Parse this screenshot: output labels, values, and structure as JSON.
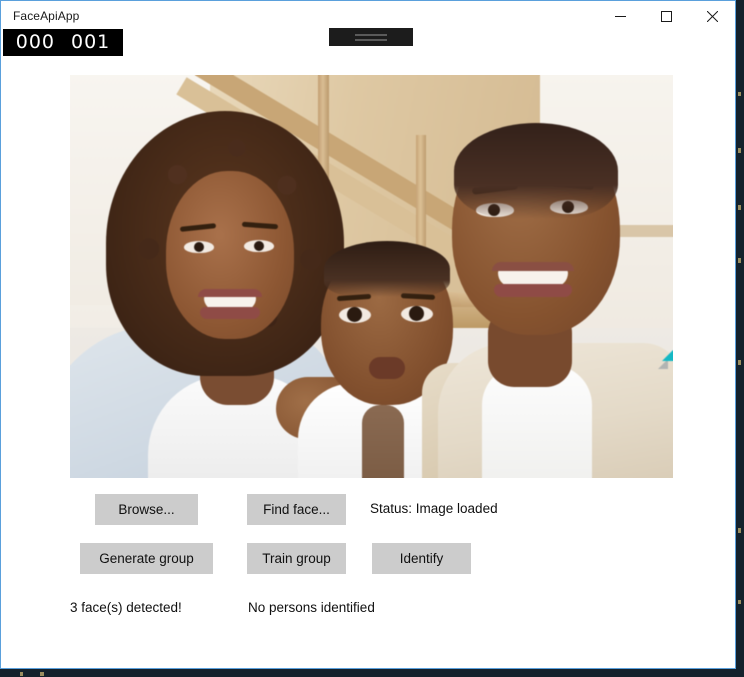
{
  "window": {
    "title": "FaceApiApp",
    "controls": {
      "minimize": "minimize-button",
      "maximize": "maximize-button",
      "close": "close-button"
    }
  },
  "overlays": {
    "face_index": {
      "left": "000",
      "right": "001"
    },
    "top_badge": {
      "lines": 2
    }
  },
  "photo": {
    "alt": "Family portrait: woman with curly hair, infant, and smiling man in a home interior with a wooden staircase",
    "subjects": [
      "mother",
      "baby",
      "father"
    ],
    "faces_detected": 3
  },
  "toolbar": {
    "browse_label": "Browse...",
    "find_face_label": "Find face...",
    "generate_group_label": "Generate group",
    "train_group_label": "Train group",
    "identify_label": "Identify"
  },
  "status": {
    "image_status": "Status: Image loaded",
    "faces_detected": "3 face(s) detected!",
    "persons_identified": "No persons identified"
  },
  "colors": {
    "window_border": "#5aa0dc",
    "button_face": "#cccccc",
    "overlay_background": "#000000",
    "overlay_text": "#ffffff",
    "text": "#101010",
    "backdrop": "#1b2b3a"
  }
}
